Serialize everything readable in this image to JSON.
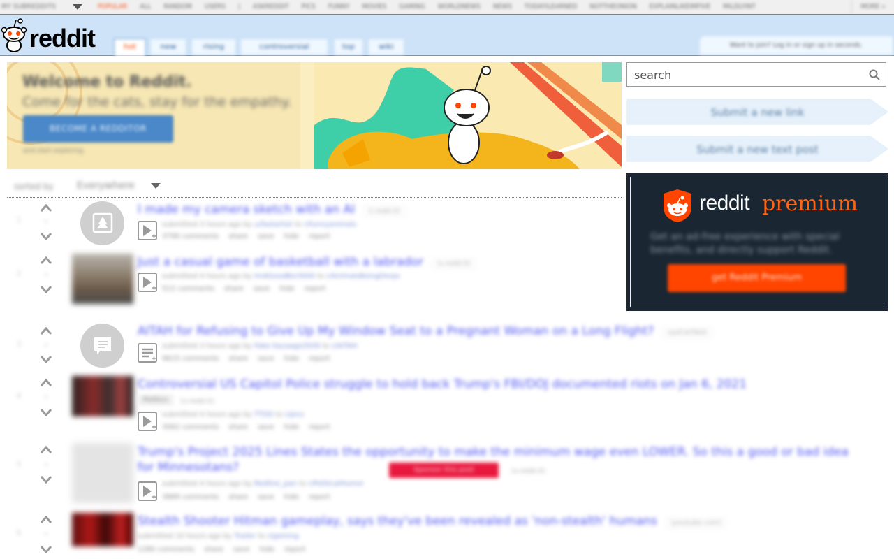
{
  "topbar": {
    "my_subreddits": "MY SUBREDDITS",
    "subreddits": [
      "POPULAR",
      "ALL",
      "RANDOM",
      "USERS",
      "|",
      "ASKREDDIT",
      "PICS",
      "FUNNY",
      "MOVIES",
      "GAMING",
      "WORLDNEWS",
      "NEWS",
      "TODAYILEARNED",
      "NOTTHEONION",
      "EXPLAINLIKEIMFIVE",
      "MILDLYINT"
    ],
    "more": "MORE »"
  },
  "header": {
    "wordmark": "reddit",
    "tabs": [
      "hot",
      "new",
      "rising",
      "controversial",
      "top",
      "wiki"
    ],
    "userbox": "Want to join? Log in or sign up in seconds."
  },
  "banner": {
    "heading": "Welcome to Reddit.",
    "tagline": "Come for the cats, stay for the empathy.",
    "button": "BECOME A REDDITOR",
    "small": "and start exploring."
  },
  "sidebar": {
    "search_placeholder": "search",
    "submit_link": "Submit a new link",
    "submit_text": "Submit a new text post",
    "premium_reddit": "reddit",
    "premium_word": "premium",
    "premium_desc": "Get an ad-free experience with special benefits, and directly support Reddit.",
    "premium_button": "get Reddit Premium"
  },
  "sortbar": {
    "label": "sorted by",
    "value": "Everywhere"
  },
  "posts": [
    {
      "rank": "1",
      "score": "•",
      "title": "I made my camera sketch with an AI",
      "domain": "(i.redd.it)",
      "tagline": "submitted 3 hours ago by",
      "author": "u/fastartist",
      "sub": "r/funnyanimals",
      "comments": "3790 comments",
      "actions": [
        "share",
        "save",
        "hide",
        "report"
      ]
    },
    {
      "rank": "2",
      "score": "•",
      "title": "Just a casual game of basketball with a labrador",
      "domain": "(v.redd.it)",
      "tagline": "submitted 4 hours ago by",
      "author": "ImAGoodBoi3000",
      "sub": "r/AnimalsBeingDerps",
      "comments": "512 comments",
      "actions": [
        "share",
        "save",
        "hide",
        "report"
      ]
    },
    {
      "rank": "3",
      "score": "•",
      "title": "AITAH for Refusing to Give Up My Window Seat to a Pregnant Woman on a Long Flight?",
      "domain": "(self.AITAH)",
      "tagline": "submitted 3 hours ago by",
      "author": "Fake-Sausage2939",
      "sub": "r/AITAH",
      "comments": "9615 comments",
      "actions": [
        "share",
        "save",
        "hide",
        "report"
      ]
    },
    {
      "rank": "4",
      "score": "•",
      "title": "Controversial US Capitol Police struggle to hold back Trump's FBI/DOJ documented riots on Jan 6, 2021",
      "domain": "(v.redd.it)",
      "tagline": "submitted 4 hours ago by",
      "author": "TTDD",
      "sub": "r/pics",
      "comments": "3062 comments",
      "actions": [
        "share",
        "save",
        "hide",
        "report"
      ],
      "flair": "Politics"
    },
    {
      "rank": "5",
      "score": "•",
      "title": "Trump's Project 2025 Lines States the opportunity to make the minimum wage even LOWER. So this a good or bad idea for Minnesotans?",
      "domain": "(v.redd.it)",
      "tagline": "submitted 4 hours ago by",
      "author": "Redline_pan",
      "sub": "r/PoliticalHumor",
      "comments": "3889 comments",
      "actions": [
        "share",
        "save",
        "hide",
        "report"
      ],
      "badge": "Sponsor this post"
    },
    {
      "rank": "6",
      "score": "•",
      "title": "Stealth Shooter Hitman gameplay, says they've been revealed as 'non-stealth' humans",
      "domain": "(youtube.com)",
      "tagline": "submitted 10 hours ago by",
      "author": "Trailer",
      "sub": "r/gaming",
      "comments": "1280 comments",
      "actions": [
        "share",
        "save",
        "hide",
        "report"
      ]
    }
  ],
  "colors": {
    "accent": "#ff4500",
    "header_bg": "#cee3f8",
    "link": "#4e55ef",
    "premium_bg": "#1a2733"
  }
}
